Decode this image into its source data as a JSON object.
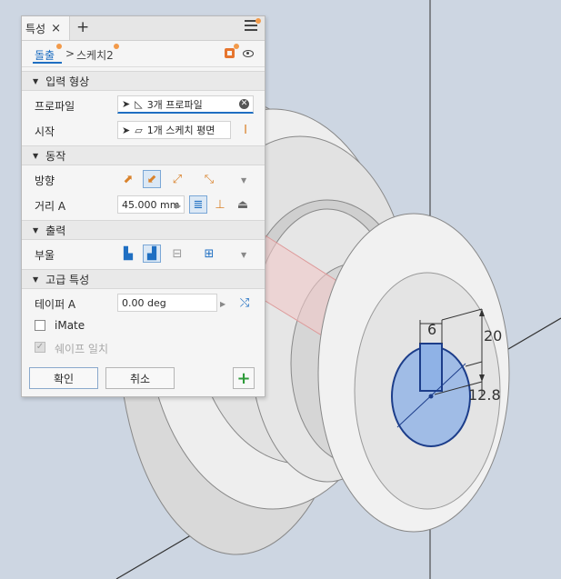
{
  "panel": {
    "tab_label": "특성",
    "tab_close": "×",
    "tab_add": "+",
    "breadcrumb": {
      "feature": "돌출",
      "separator": ">",
      "sketch": "스케치2"
    },
    "sections": {
      "input_geometry": {
        "title": "입력 형상",
        "profile_label": "프로파일",
        "profile_value": "3개 프로파일",
        "start_label": "시작",
        "start_value": "1개 스케치 평면"
      },
      "behavior": {
        "title": "동작",
        "direction_label": "방향",
        "distance_label": "거리 A",
        "distance_value": "45.000 mm"
      },
      "output": {
        "title": "출력",
        "boolean_label": "부울"
      },
      "advanced": {
        "title": "고급 특성",
        "taper_label": "테이퍼 A",
        "taper_value": "0.00 deg",
        "imate_label": "iMate",
        "imate_checked": false,
        "shape_match_label": "쉐이프 일치",
        "shape_match_checked": true
      }
    },
    "ok_label": "확인",
    "cancel_label": "취소",
    "add_label": "+"
  },
  "viewport": {
    "dim_6": "6",
    "dim_20": "20",
    "dim_12_8": "12.8"
  },
  "colors": {
    "accent": "#1f6fc2",
    "notify": "#f29a4a",
    "add_green": "#2e9b3a"
  }
}
